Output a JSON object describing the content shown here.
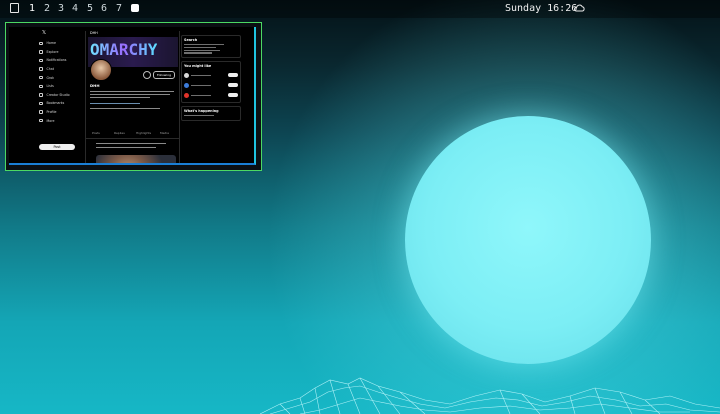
{
  "topbar": {
    "workspace_icon": "window-grid-icon",
    "workspaces": [
      "1",
      "2",
      "3",
      "4",
      "5",
      "6",
      "7"
    ],
    "active_workspace": "1",
    "special_workspace_icon": "square-filled-icon",
    "clock": "Sunday 16:26",
    "weather_icon": "cloud-icon"
  },
  "window": {
    "app": "X (Twitter) profile in browser",
    "banner_text": "OMARCHY",
    "nav_items": [
      "Home",
      "Explore",
      "Notifications",
      "Chat",
      "Grok",
      "Lists",
      "Creator Studio",
      "Bookmarks",
      "Profile",
      "More"
    ],
    "post_button": "Post",
    "follow_button": "Following",
    "profile_name": "DHH",
    "tabs": [
      "Posts",
      "Replies",
      "Highlights",
      "Media"
    ],
    "side_boxes": [
      "Search",
      "You might like",
      "What's happening"
    ],
    "border_color": "#4cd963"
  },
  "colors": {
    "sky_top": "#041217",
    "sky_bottom": "#16b7c6",
    "sun": "#7ceef5"
  }
}
